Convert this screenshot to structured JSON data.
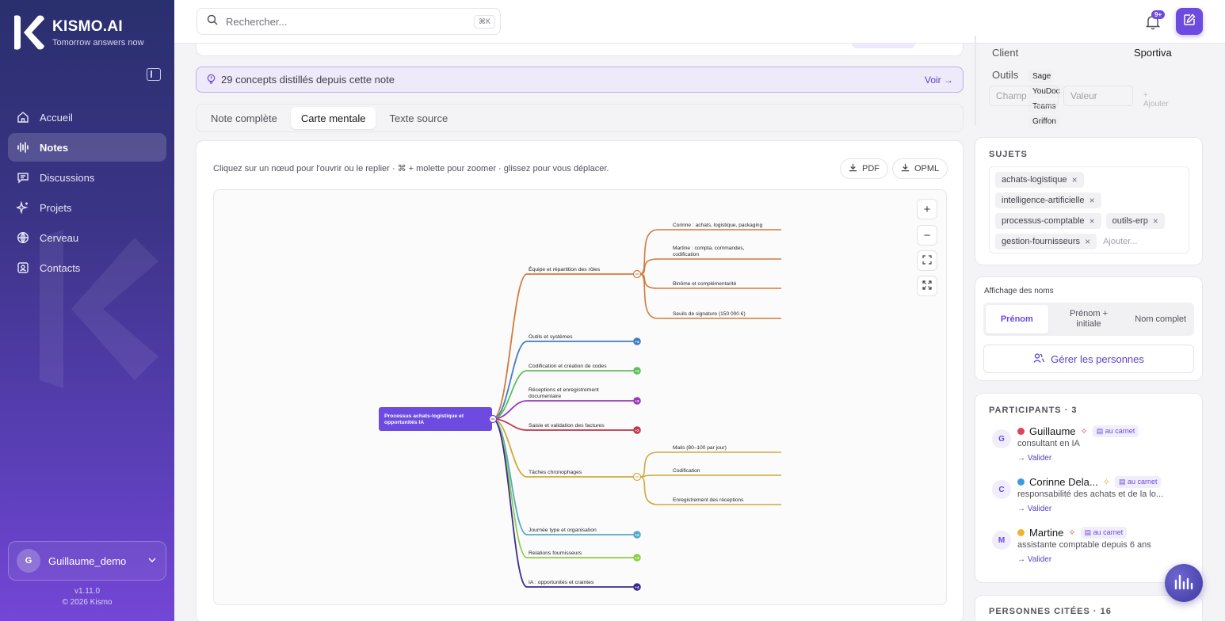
{
  "brand": {
    "name": "KISMO.AI",
    "tagline": "Tomorrow answers now"
  },
  "sidebar": {
    "items": [
      {
        "label": "Accueil",
        "icon": "home-icon",
        "active": false
      },
      {
        "label": "Notes",
        "icon": "waveform-icon",
        "active": true
      },
      {
        "label": "Discussions",
        "icon": "chat-icon",
        "active": false
      },
      {
        "label": "Projets",
        "icon": "sparkle-icon",
        "active": false
      },
      {
        "label": "Cerveau",
        "icon": "brain-icon",
        "active": false
      },
      {
        "label": "Contacts",
        "icon": "contact-card-icon",
        "active": false
      }
    ],
    "user": {
      "initial": "G",
      "name": "Guillaume_demo"
    },
    "version": "v1.11.0",
    "copyright": "© 2026 Kismo"
  },
  "topbar": {
    "search_placeholder": "Rechercher...",
    "search_shortcut": "⌘K",
    "notif_badge": "9+"
  },
  "concepts_banner": {
    "text": "29 concepts distillés depuis cette note",
    "action": "Voir →"
  },
  "tabs": [
    {
      "label": "Note complète",
      "active": false
    },
    {
      "label": "Carte mentale",
      "active": true
    },
    {
      "label": "Texte source",
      "active": false
    }
  ],
  "mindmap": {
    "hint": "Cliquez sur un nœud pour l'ouvrir ou le replier · ⌘ + molette pour zoomer · glissez pour vous déplacer.",
    "export_pdf": "PDF",
    "export_opml": "OPML",
    "root": "Processus achats-logistique et opportunités IA",
    "branches": [
      {
        "label": "Équipe et répartition des rôles",
        "color": "#d27a3b",
        "expanded": true,
        "badge": "",
        "children": [
          "Corinne : achats, logistique, packaging",
          "Martine : compta, commandes, codification",
          "Binôme et complémentarité",
          "Seuils de signature (150 000 €)"
        ]
      },
      {
        "label": "Outils et systèmes",
        "color": "#3f7dc0",
        "badge": "+4"
      },
      {
        "label": "Codification et création de codes",
        "color": "#5cbf5a",
        "badge": "+3"
      },
      {
        "label": "Réceptions et enregistrement documentaire",
        "color": "#9a38b8",
        "badge": "+3"
      },
      {
        "label": "Saisie et validation des factures",
        "color": "#c2334c",
        "badge": "+3"
      },
      {
        "label": "Tâches chronophages",
        "color": "#d0a93b",
        "expanded": true,
        "badge": "",
        "children": [
          "Mails (80–100 par jour)",
          "Codification",
          "Enregistrement des réceptions"
        ]
      },
      {
        "label": "Journée type et organisation",
        "color": "#56a8c9",
        "badge": "+2"
      },
      {
        "label": "Relations fournisseurs",
        "color": "#8ccf48",
        "badge": "+3"
      },
      {
        "label": "IA : opportunités et craintes",
        "color": "#3c2a8e",
        "badge": "+4"
      }
    ]
  },
  "meta": {
    "client_label": "Client",
    "client_value": "Sportiva",
    "tools_label": "Outils",
    "tools": [
      "Sage",
      "YouDoc",
      "Teams",
      "Griffon"
    ],
    "field_placeholder": "Champ",
    "value_placeholder": "Valeur",
    "add_label": "+ Ajouter"
  },
  "subjects": {
    "title": "SUJETS",
    "tags": [
      "achats-logistique",
      "intelligence-artificielle",
      "processus-comptable",
      "outils-erp",
      "gestion-fournisseurs"
    ],
    "add_placeholder": "Ajouter..."
  },
  "names_display": {
    "title": "Affichage des noms",
    "options": [
      "Prénom",
      "Prénom + initiale",
      "Nom complet"
    ],
    "selected": "Prénom",
    "manage": "Gérer les personnes"
  },
  "participants": {
    "title": "PARTICIPANTS · 3",
    "people": [
      {
        "initial": "G",
        "name": "Guillaume",
        "dot": "#e0435a",
        "carnet": "au carnet",
        "role": "consultant en IA",
        "validate": "→ Valider"
      },
      {
        "initial": "C",
        "name": "Corinne Dela...",
        "dot": "#3b9be0",
        "carnet": "au carnet",
        "role": "responsabilité des achats et de la lo...",
        "validate": "→ Valider"
      },
      {
        "initial": "M",
        "name": "Martine",
        "dot": "#f2b233",
        "carnet": "au carnet",
        "role": "assistante comptable depuis 6 ans",
        "validate": "→ Valider"
      }
    ]
  },
  "cited": {
    "title": "PERSONNES CITÉES · 16"
  }
}
